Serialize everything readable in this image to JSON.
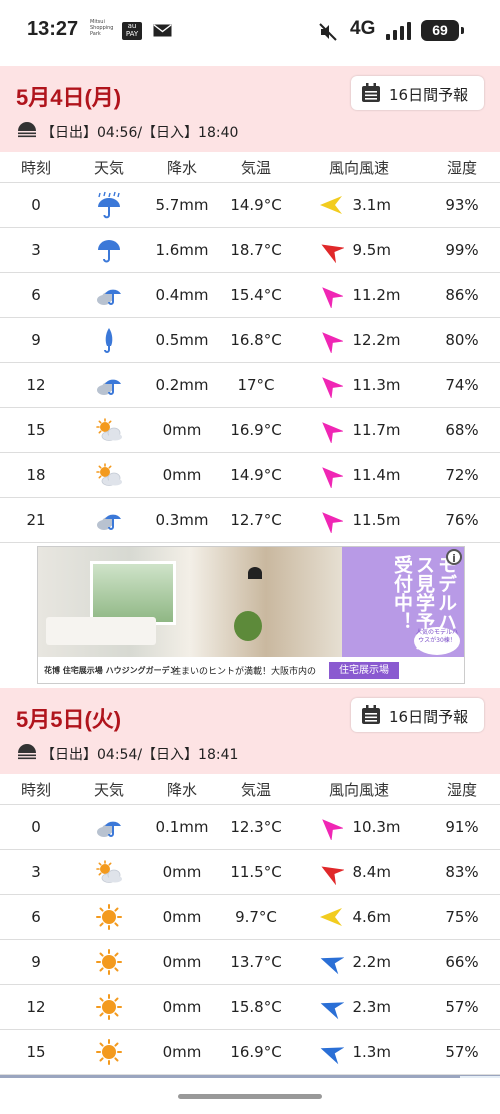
{
  "status_bar": {
    "time": "13:27",
    "notif_mitsui": "Mitsui Shopping Park",
    "notif_aupay": "au PAY",
    "network": "4G",
    "battery": "69"
  },
  "colors": {
    "header_bg": "#fde3e4",
    "date_red": "#b0141c",
    "umbrella_blue": "#3b78d8",
    "sun_orange": "#f39a1e",
    "wind_yellow": "#f2cc1f",
    "wind_red": "#e0282a",
    "wind_magenta": "#f026b4",
    "wind_blue": "#2a6fd6"
  },
  "days": [
    {
      "date": "5月4日(月)",
      "forecast_button": "16日間予報",
      "sun_times": "【日出】04:56/【日入】18:40",
      "headers": [
        "時刻",
        "天気",
        "降水",
        "気温",
        "風向風速",
        "湿度"
      ],
      "rows": [
        {
          "time": "0",
          "weather_icon": "heavy-rain-umbrella-icon",
          "precip": "5.7mm",
          "temp": "14.9°C",
          "wind_icon": "wind-arrow-yellow-icon",
          "wind": "3.1m",
          "humidity": "93%"
        },
        {
          "time": "3",
          "weather_icon": "umbrella-icon",
          "precip": "1.6mm",
          "temp": "18.7°C",
          "wind_icon": "wind-arrow-red-icon",
          "wind": "9.5m",
          "humidity": "99%"
        },
        {
          "time": "6",
          "weather_icon": "cloud-umbrella-icon",
          "precip": "0.4mm",
          "temp": "15.4°C",
          "wind_icon": "wind-arrow-magenta-icon",
          "wind": "11.2m",
          "humidity": "86%"
        },
        {
          "time": "9",
          "weather_icon": "closed-umbrella-icon",
          "precip": "0.5mm",
          "temp": "16.8°C",
          "wind_icon": "wind-arrow-magenta-icon",
          "wind": "12.2m",
          "humidity": "80%"
        },
        {
          "time": "12",
          "weather_icon": "cloud-umbrella-icon",
          "precip": "0.2mm",
          "temp": "17°C",
          "wind_icon": "wind-arrow-magenta-icon",
          "wind": "11.3m",
          "humidity": "74%"
        },
        {
          "time": "15",
          "weather_icon": "sun-cloud-icon",
          "precip": "0mm",
          "temp": "16.9°C",
          "wind_icon": "wind-arrow-magenta-icon",
          "wind": "11.7m",
          "humidity": "68%"
        },
        {
          "time": "18",
          "weather_icon": "sun-cloud-icon",
          "precip": "0mm",
          "temp": "14.9°C",
          "wind_icon": "wind-arrow-magenta-icon",
          "wind": "11.4m",
          "humidity": "72%"
        },
        {
          "time": "21",
          "weather_icon": "cloud-umbrella-icon",
          "precip": "0.3mm",
          "temp": "12.7°C",
          "wind_icon": "wind-arrow-magenta-icon",
          "wind": "11.5m",
          "humidity": "76%"
        }
      ]
    },
    {
      "date": "5月5日(火)",
      "forecast_button": "16日間予報",
      "sun_times": "【日出】04:54/【日入】18:41",
      "headers": [
        "時刻",
        "天気",
        "降水",
        "気温",
        "風向風速",
        "湿度"
      ],
      "rows": [
        {
          "time": "0",
          "weather_icon": "cloud-umbrella-icon",
          "precip": "0.1mm",
          "temp": "12.3°C",
          "wind_icon": "wind-arrow-magenta-icon",
          "wind": "10.3m",
          "humidity": "91%"
        },
        {
          "time": "3",
          "weather_icon": "sun-cloud-icon",
          "precip": "0mm",
          "temp": "11.5°C",
          "wind_icon": "wind-arrow-red-icon",
          "wind": "8.4m",
          "humidity": "83%"
        },
        {
          "time": "6",
          "weather_icon": "sun-icon",
          "precip": "0mm",
          "temp": "9.7°C",
          "wind_icon": "wind-arrow-yellow-icon",
          "wind": "4.6m",
          "humidity": "75%"
        },
        {
          "time": "9",
          "weather_icon": "sun-icon",
          "precip": "0mm",
          "temp": "13.7°C",
          "wind_icon": "wind-arrow-blue-icon",
          "wind": "2.2m",
          "humidity": "66%"
        },
        {
          "time": "12",
          "weather_icon": "sun-icon",
          "precip": "0mm",
          "temp": "15.8°C",
          "wind_icon": "wind-arrow-blue-icon",
          "wind": "2.3m",
          "humidity": "57%"
        },
        {
          "time": "15",
          "weather_icon": "sun-icon",
          "precip": "0mm",
          "temp": "16.9°C",
          "wind_icon": "wind-arrow-blue-icon",
          "wind": "1.3m",
          "humidity": "57%"
        }
      ]
    }
  ],
  "ad": {
    "vertical_text": "モデルハウス見学予約受付中！",
    "badge": "人気のモデルハウスが30棟！",
    "logo": "花博 住宅展示場 ハウジングガーデン",
    "tagline": "住まいのヒントが満載！大阪市内の",
    "cta": "住宅展示場",
    "info": "i"
  }
}
